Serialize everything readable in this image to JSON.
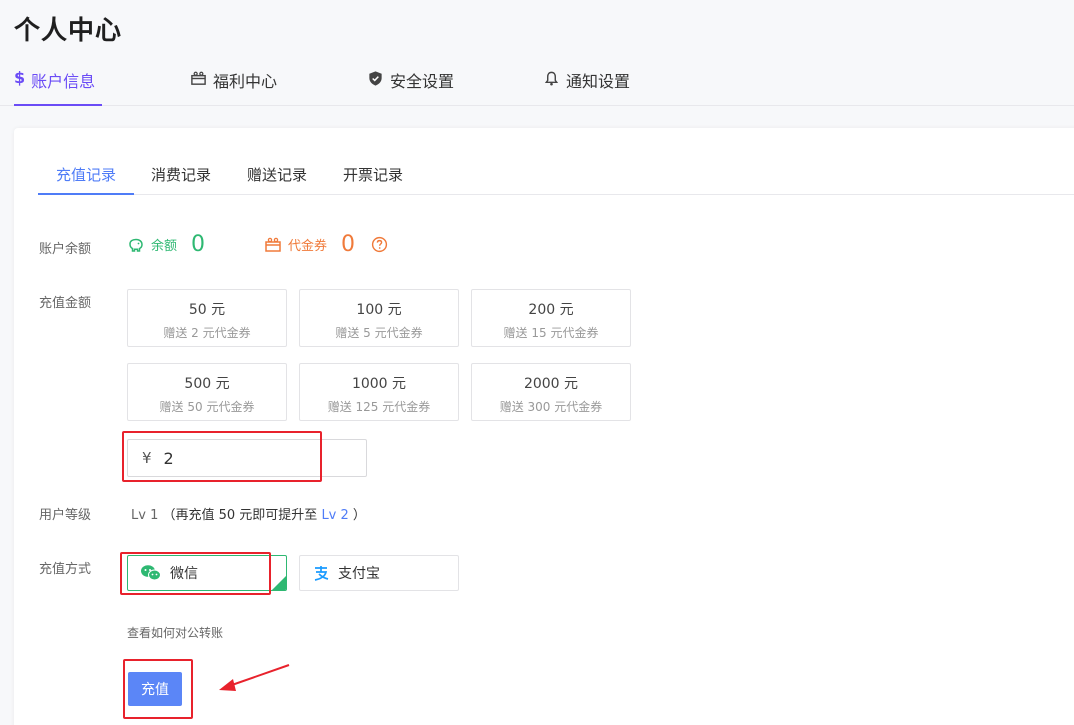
{
  "page": {
    "title": "个人中心"
  },
  "top_tabs": [
    {
      "label": "账户信息",
      "icon": "dollar-icon",
      "active": true
    },
    {
      "label": "福利中心",
      "icon": "gift-icon",
      "active": false
    },
    {
      "label": "安全设置",
      "icon": "shield-icon",
      "active": false
    },
    {
      "label": "通知设置",
      "icon": "bell-icon",
      "active": false
    }
  ],
  "sub_tabs": [
    {
      "label": "充值记录",
      "active": true
    },
    {
      "label": "消费记录",
      "active": false
    },
    {
      "label": "赠送记录",
      "active": false
    },
    {
      "label": "开票记录",
      "active": false
    }
  ],
  "balance": {
    "label": "账户余额",
    "cash_label": "余额",
    "cash_value": "0",
    "voucher_label": "代金券",
    "voucher_value": "0"
  },
  "recharge": {
    "label": "充值金额",
    "options": [
      {
        "amount": "50 元",
        "gift": "赠送 2 元代金券"
      },
      {
        "amount": "100 元",
        "gift": "赠送 5 元代金券"
      },
      {
        "amount": "200 元",
        "gift": "赠送 15 元代金券"
      },
      {
        "amount": "500 元",
        "gift": "赠送 50 元代金券"
      },
      {
        "amount": "1000 元",
        "gift": "赠送 125 元代金券"
      },
      {
        "amount": "2000 元",
        "gift": "赠送 300 元代金券"
      }
    ],
    "currency_symbol": "¥",
    "custom_value": "2"
  },
  "level": {
    "label": "用户等级",
    "current": "Lv 1",
    "hint_prefix": "（再充值 50 元即可提升至",
    "next": "Lv 2",
    "hint_suffix": "）"
  },
  "payment": {
    "label": "充值方式",
    "methods": [
      {
        "label": "微信",
        "icon": "wechat-icon",
        "selected": true
      },
      {
        "label": "支付宝",
        "icon": "alipay-icon",
        "selected": false
      }
    ],
    "transfer_link": "查看如何对公转账",
    "submit_label": "充值"
  },
  "colors": {
    "primary_purple": "#6b4cf6",
    "primary_blue": "#4f7cf7",
    "button_blue": "#5b86f7",
    "green": "#2eb872",
    "orange": "#f07a3a",
    "annotation_red": "#e8222c"
  }
}
